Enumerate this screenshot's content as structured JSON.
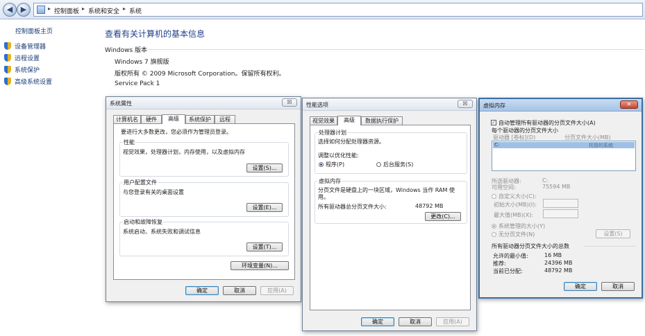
{
  "address": {
    "crumbs": [
      "控制面板",
      "系统和安全",
      "系统"
    ]
  },
  "sidebar": {
    "home": "控制面板主页",
    "items": [
      "设备管理器",
      "远程设置",
      "系统保护",
      "高级系统设置"
    ]
  },
  "main": {
    "title": "查看有关计算机的基本信息",
    "group": "Windows 版本",
    "edition": "Windows 7 旗舰版",
    "copyright": "版权所有 © 2009 Microsoft Corporation。保留所有权利。",
    "service_pack": "Service Pack 1"
  },
  "sysprops": {
    "title": "系统属性",
    "close": "☒",
    "tabs": [
      "计算机名",
      "硬件",
      "高级",
      "系统保护",
      "远程"
    ],
    "admin_note": "要进行大多数更改，您必须作为管理员登录。",
    "perf": {
      "label": "性能",
      "desc": "视觉效果，处理器计划，内存使用，以及虚拟内存",
      "button": "设置(S)..."
    },
    "profile": {
      "label": "用户配置文件",
      "desc": "与您登录有关的桌面设置",
      "button": "设置(E)..."
    },
    "startup": {
      "label": "启动和故障恢复",
      "desc": "系统启动、系统失败和调试信息",
      "button": "设置(T)..."
    },
    "env_button": "环境变量(N)...",
    "ok": "确定",
    "cancel": "取消",
    "apply": "应用(A)"
  },
  "perfopts": {
    "title": "性能选项",
    "close": "☒",
    "tabs": [
      "视觉效果",
      "高级",
      "数据执行保护"
    ],
    "sched": {
      "label": "处理器计划",
      "desc": "选择如何分配处理器资源。",
      "adjust": "调整以优化性能:",
      "programs": "程序(P)",
      "background": "后台服务(S)"
    },
    "vm": {
      "label": "虚拟内存",
      "desc1": "分页文件是硬盘上的一块区域，Windows 当作 RAM 使",
      "desc2": "用。",
      "total_label": "所有驱动器总分页文件大小:",
      "total_value": "48792 MB",
      "change": "更改(C)..."
    },
    "ok": "确定",
    "cancel": "取消",
    "apply": "应用(A)"
  },
  "vmem": {
    "title": "虚拟内存",
    "close": "✕",
    "auto_label": "自动管理所有驱动器的分页文件大小(A)",
    "per_drive": "每个驱动器的分页文件大小",
    "col_drive": "驱动器 [卷标](D)",
    "col_size": "分页文件大小(MB)",
    "row_value": "托管的系统",
    "selected_drive_label": "所选驱动器:",
    "selected_drive_value": "C:",
    "available_label": "可用空间:",
    "available_value": "75594 MB",
    "custom": "自定义大小(C):",
    "initial": "初始大小(MB)(I):",
    "max": "最大值(MB)(X):",
    "system_managed": "系统管理的大小(Y)",
    "no_paging": "无分页文件(N)",
    "set_button": "设置(S)",
    "total_header": "所有驱动器分页文件大小的总数",
    "min_label": "允许的最小值:",
    "min_value": "16 MB",
    "rec_label": "推荐:",
    "rec_value": "24396 MB",
    "cur_label": "当前已分配:",
    "cur_value": "48792 MB",
    "ok": "确定",
    "cancel": "取消"
  }
}
